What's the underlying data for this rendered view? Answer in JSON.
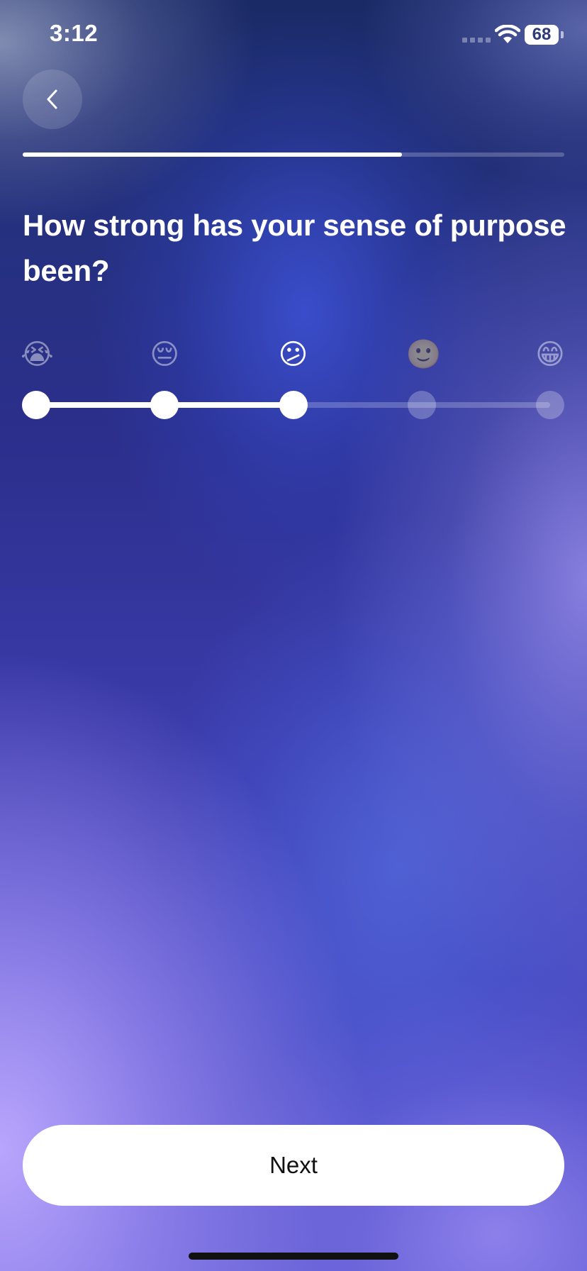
{
  "status_bar": {
    "time": "3:12",
    "battery": "68",
    "icons": [
      "signal-icon",
      "wifi-icon",
      "battery-icon"
    ]
  },
  "navigation": {
    "back_icon": "chevron-left-icon"
  },
  "progress": {
    "fraction": 0.7
  },
  "question": {
    "title": "How strong has your sense of purpose been?"
  },
  "scale": {
    "options": [
      {
        "emoji": "😭",
        "icon": "loudly-crying-face-icon"
      },
      {
        "emoji": "😔",
        "icon": "pensive-face-icon"
      },
      {
        "emoji": "😕",
        "icon": "confused-face-icon"
      },
      {
        "emoji": "🙂",
        "icon": "slightly-smiling-face-icon"
      },
      {
        "emoji": "😁",
        "icon": "beaming-face-icon"
      }
    ],
    "selected_index": 2
  },
  "next_button": {
    "label": "Next"
  },
  "colors": {
    "accent": "#ffffff",
    "button_text": "#111111",
    "background_top": "#1a2a66",
    "background_bottom": "#5b58cf"
  }
}
